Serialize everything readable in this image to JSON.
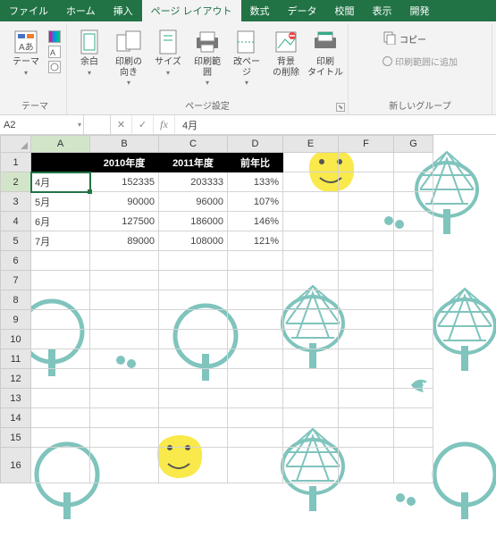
{
  "menu": {
    "tabs": [
      "ファイル",
      "ホーム",
      "挿入",
      "ページ レイアウト",
      "数式",
      "データ",
      "校閲",
      "表示",
      "開発"
    ],
    "active_index": 3
  },
  "ribbon": {
    "themes": {
      "label": "テーマ",
      "btn": "テーマ"
    },
    "page_setup": {
      "label": "ページ設定",
      "margins": "余白",
      "orientation": "印刷の\n向き",
      "size": "サイズ",
      "print_area": "印刷範囲",
      "breaks": "改ページ",
      "background": "背景\nの削除",
      "print_titles": "印刷\nタイトル"
    },
    "new_group": {
      "label": "新しいグループ",
      "copy": "コピー",
      "add_to_print_area": "印刷範囲に追加"
    }
  },
  "namebox": "A2",
  "formula": "4月",
  "columns": [
    "A",
    "B",
    "C",
    "D",
    "E",
    "F",
    "G"
  ],
  "rows": [
    "1",
    "2",
    "3",
    "4",
    "5",
    "6",
    "7",
    "8",
    "9",
    "10",
    "11",
    "12",
    "13",
    "14",
    "15",
    "16"
  ],
  "table": {
    "headers": {
      "b": "2010年度",
      "c": "2011年度",
      "d": "前年比"
    },
    "rows": [
      {
        "a": "4月",
        "b": "152335",
        "c": "203333",
        "d": "133%"
      },
      {
        "a": "5月",
        "b": "90000",
        "c": "96000",
        "d": "107%"
      },
      {
        "a": "6月",
        "b": "127500",
        "c": "186000",
        "d": "146%"
      },
      {
        "a": "7月",
        "b": "89000",
        "c": "108000",
        "d": "121%"
      }
    ]
  },
  "chart_data": {
    "type": "table",
    "title": "",
    "columns": [
      "",
      "2010年度",
      "2011年度",
      "前年比"
    ],
    "rows": [
      [
        "4月",
        152335,
        203333,
        "133%"
      ],
      [
        "5月",
        90000,
        96000,
        "107%"
      ],
      [
        "6月",
        127500,
        186000,
        "146%"
      ],
      [
        "7月",
        89000,
        108000,
        "121%"
      ]
    ]
  }
}
